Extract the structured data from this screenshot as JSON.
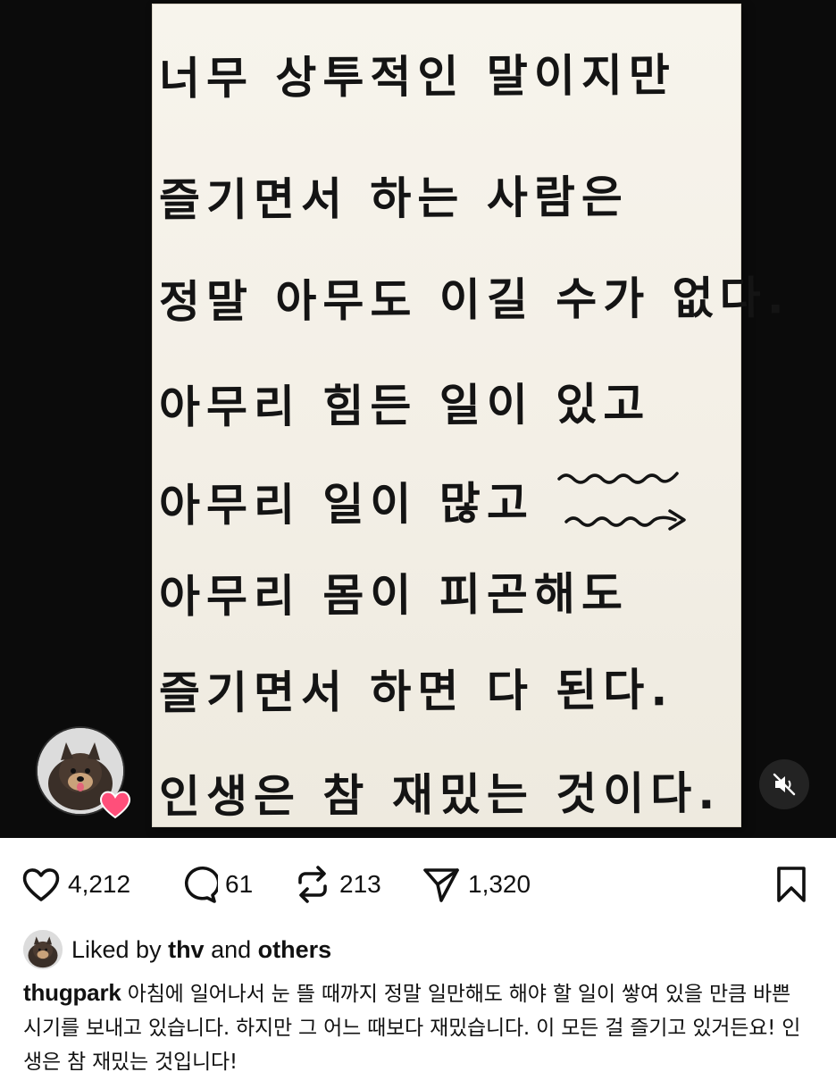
{
  "post": {
    "handwritten_lines": [
      "너무 상투적인 말이지만",
      "즐기면서 하는 사람은",
      "정말 아무도 이길 수가 없다.",
      "아무리 힘든 일이 있고",
      "아무리 일이 많고",
      "아무리 몸이 피곤해도",
      "즐기면서 하면 다 된다.",
      "인생은 참 재밌는 것이다."
    ],
    "poster_avatar_icon": "dog-avatar-icon",
    "mute_icon": "speaker-muted-icon"
  },
  "actions": {
    "like_count": "4,212",
    "comment_count": "61",
    "repost_count": "213",
    "share_count": "1,320"
  },
  "likes": {
    "prefix": "Liked by ",
    "user": "thv",
    "middle": " and ",
    "others": "others"
  },
  "caption": {
    "username": "thugpark",
    "text": " 아침에 일어나서 눈 뜰 때까지 정말 일만해도 해야 할 일이 쌓여 있을 만큼 바쁜 시기를 보내고 있습니다. 하지만 그 어느 때보다 재밌습니다. 이 모든 걸 즐기고 있거든요! 인생은 참 재밌는 것입니다!"
  },
  "colors": {
    "background": "#ffffff",
    "media_background": "#0b0b0b",
    "paper": "#f5f2ea",
    "ink": "#141414",
    "heart_badge": "#ff4f7a"
  }
}
